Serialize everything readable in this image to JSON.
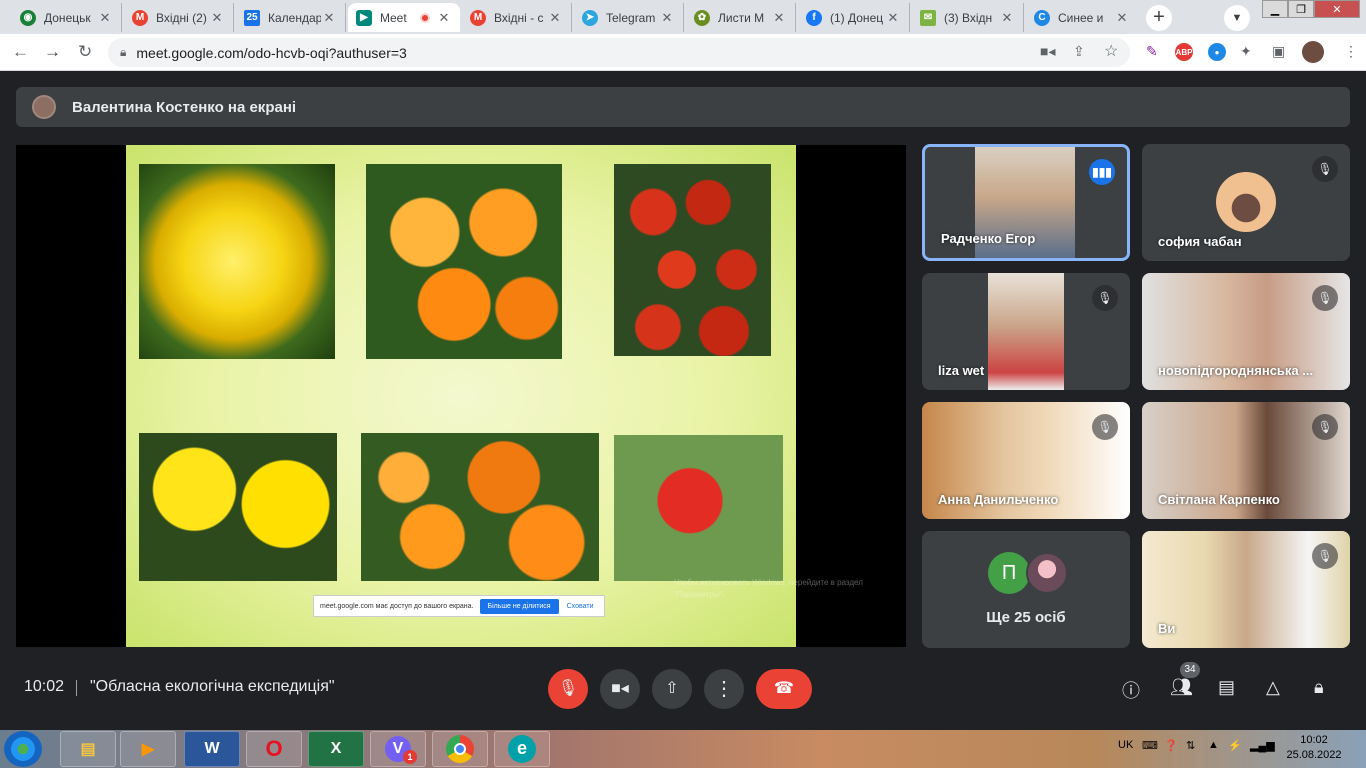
{
  "browser": {
    "tabs": [
      {
        "label": "Донецьк",
        "color": "#188038",
        "glyph": "◉"
      },
      {
        "label": "Вхідні (2)",
        "color": "#ea4335",
        "glyph": "M"
      },
      {
        "label": "Календар",
        "color": "#1a73e8",
        "glyph": "25"
      },
      {
        "label": "Meet",
        "color": "#00897b",
        "glyph": "▶"
      },
      {
        "label": "Вхідні - с",
        "color": "#ea4335",
        "glyph": "M"
      },
      {
        "label": "Telegram",
        "color": "#2ca5e0",
        "glyph": "➤"
      },
      {
        "label": "Листи М",
        "color": "#6b8e23",
        "glyph": "✿"
      },
      {
        "label": "(1) Донец",
        "color": "#1877f2",
        "glyph": "f"
      },
      {
        "label": "(3) Вхідн",
        "color": "#7cb342",
        "glyph": "✉"
      },
      {
        "label": "Синее и",
        "color": "#1e88e5",
        "glyph": "C"
      }
    ],
    "url": "meet.google.com/odo-hcvb-oqi?authuser=3",
    "extensions": [
      "ABP"
    ]
  },
  "meet": {
    "presenter_label": "Валентина Костенко на екрані",
    "share_bar": {
      "text": "meet.google.com має доступ до вашого екрана.",
      "stop_label": "Більше не ділитися",
      "hide_label": "Сховати"
    },
    "windows_watermark": "Чтобы активировать Windows, перейдите в раздел \"Параметры\".",
    "participants": [
      {
        "name": "Радченко Егор",
        "speaking": true
      },
      {
        "name": "софия чабан",
        "speaking": false
      },
      {
        "name": "liza wet",
        "speaking": false
      },
      {
        "name": "новопідгороднянська ...",
        "speaking": false
      },
      {
        "name": "Анна Данильченко",
        "speaking": false
      },
      {
        "name": "Світлана Карпенко",
        "speaking": false
      },
      {
        "name": "Ви",
        "speaking": false
      }
    ],
    "more_people": {
      "avatar_letter": "П",
      "label": "Ще 25 осіб"
    },
    "time": "10:02",
    "meeting_title": "\"Обласна екологічна експедиція\"",
    "participant_count": "34"
  },
  "taskbar": {
    "apps": [
      {
        "label": "▤",
        "color": "#f4c542"
      },
      {
        "label": "▶",
        "color": "#ff9800"
      },
      {
        "label": "W",
        "color": "#2b579a"
      },
      {
        "label": "O",
        "color": "#e81123"
      },
      {
        "label": "X",
        "color": "#217346"
      },
      {
        "label": "V",
        "color": "#7360f2"
      },
      {
        "label": "●",
        "color": "#4285f4"
      },
      {
        "label": "e",
        "color": "#00a1a8"
      }
    ],
    "viber_badge": "1",
    "language": "UK",
    "clock_time": "10:02",
    "clock_date": "25.08.2022"
  }
}
